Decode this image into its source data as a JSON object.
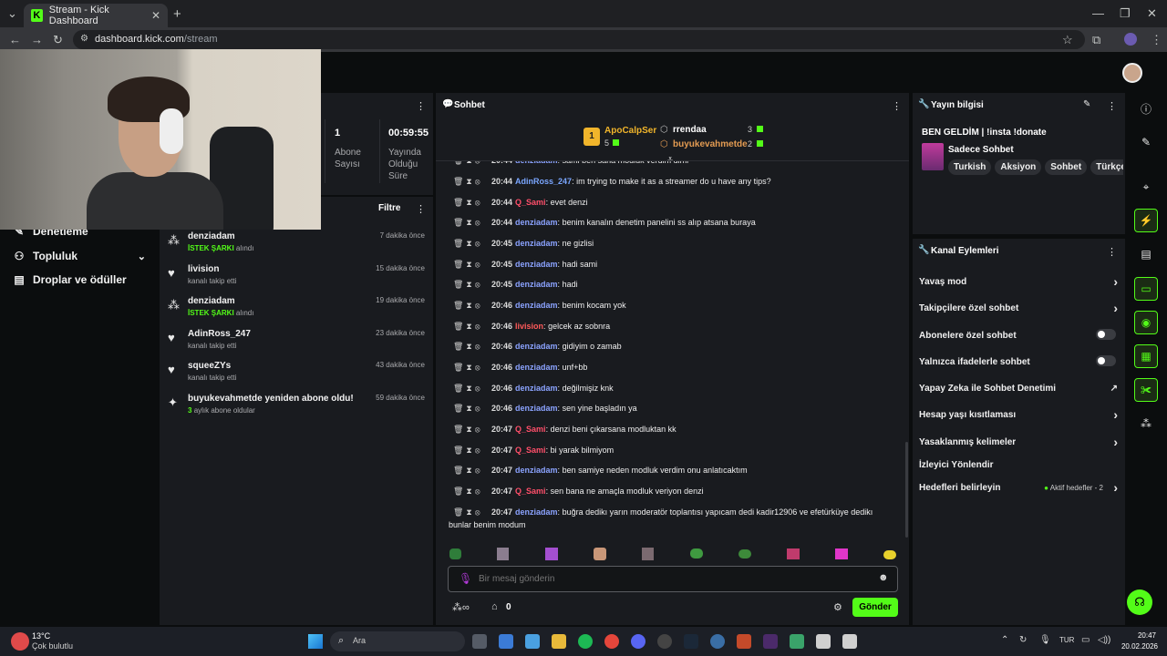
{
  "browser": {
    "tab_title": "Stream - Kick Dashboard",
    "url_host": "dashboard.kick.com",
    "url_path": "/stream",
    "favicon_letter": "K"
  },
  "sidebar": {
    "items": [
      {
        "label": "Denetleme",
        "icon": "shield-icon"
      },
      {
        "label": "Topluluk",
        "icon": "people-icon"
      },
      {
        "label": "Droplar ve ödüller",
        "icon": "gift-icon"
      }
    ]
  },
  "stats": {
    "subs_value": "1",
    "subs_label_1": "Abone",
    "subs_label_2": "Sayısı",
    "uptime_value": "00:59:55",
    "uptime_label_1": "Yayında",
    "uptime_label_2": "Olduğu",
    "uptime_label_3": "Süre"
  },
  "activity": {
    "filter_label": "Filtre",
    "items": [
      {
        "user": "denziadam",
        "desc_highlight": "İSTEK ŞARKI",
        "desc": "alındı",
        "time": "7 dakika önce",
        "icon": "bits-icon"
      },
      {
        "user": "livision",
        "desc_highlight": "",
        "desc": "kanalı takip etti",
        "time": "15 dakika önce",
        "icon": "heart-icon"
      },
      {
        "user": "denziadam",
        "desc_highlight": "İSTEK ŞARKI",
        "desc": "alındı",
        "time": "19 dakika önce",
        "icon": "bits-icon"
      },
      {
        "user": "AdinRoss_247",
        "desc_highlight": "",
        "desc": "kanalı takip etti",
        "time": "23 dakika önce",
        "icon": "heart-icon"
      },
      {
        "user": "squeeZYs",
        "desc_highlight": "",
        "desc": "kanalı takip etti",
        "time": "43 dakika önce",
        "icon": "heart-icon"
      },
      {
        "user": "buyukevahmetde yeniden abone oldu!",
        "desc_highlight": "3",
        "desc": "aylık abone oldular",
        "time": "59 dakika önce",
        "icon": "star-icon"
      }
    ]
  },
  "chat": {
    "title": "Sohbet",
    "leaderboard": {
      "first_user": "ApoCalpSer",
      "first_count": "5",
      "first_rank": "1",
      "second_user": "rrendaa",
      "second_count": "3",
      "third_user": "buyukevahmetde",
      "third_count": "2"
    },
    "messages": [
      {
        "time": "20:44",
        "user": "denziadam",
        "text": "sami ben sana modluk verdim dimi",
        "color": "den"
      },
      {
        "time": "20:44",
        "user": "AdinRoss_247",
        "text": "im trying to make it as a streamer do u have any tips?",
        "color": "blue"
      },
      {
        "time": "20:44",
        "user": "Q_Sami",
        "text": "evet denzi",
        "color": "red"
      },
      {
        "time": "20:44",
        "user": "denziadam",
        "text": "benim kanalın denetim panelini ss alıp atsana buraya",
        "color": "den"
      },
      {
        "time": "20:45",
        "user": "denziadam",
        "text": "ne gizlisi",
        "color": "den"
      },
      {
        "time": "20:45",
        "user": "denziadam",
        "text": "hadi sami",
        "color": "den"
      },
      {
        "time": "20:45",
        "user": "denziadam",
        "text": "hadi",
        "color": "den"
      },
      {
        "time": "20:46",
        "user": "denziadam",
        "text": "benim kocam yok",
        "color": "den"
      },
      {
        "time": "20:46",
        "user": "livision",
        "text": "gelcek az sobnra",
        "color": "red2"
      },
      {
        "time": "20:46",
        "user": "denziadam",
        "text": "gidiyim o zamab",
        "color": "den"
      },
      {
        "time": "20:46",
        "user": "denziadam",
        "text": "unf+bb",
        "color": "den"
      },
      {
        "time": "20:46",
        "user": "denziadam",
        "text": "değilmişiz knk",
        "color": "den"
      },
      {
        "time": "20:46",
        "user": "denziadam",
        "text": "sen yine başladın ya",
        "color": "den"
      },
      {
        "time": "20:47",
        "user": "Q_Sami",
        "text": "denzi beni çıkarsana modluktan kk",
        "color": "red"
      },
      {
        "time": "20:47",
        "user": "Q_Sami",
        "text": "bi yarak bilmiyom",
        "color": "red"
      },
      {
        "time": "20:47",
        "user": "denziadam",
        "text": "ben samiye neden modluk verdim onu anlatıcaktım",
        "color": "den"
      },
      {
        "time": "20:47",
        "user": "Q_Sami",
        "text": "sen bana ne amaçla modluk veriyon denzi",
        "color": "red"
      },
      {
        "time": "20:47",
        "user": "denziadam",
        "text": "buğra dedikı yarın moderatör toplantısı yapıcam dedi kadir12906 ve efetürküye dedikı",
        "color": "den"
      }
    ],
    "last_line_cont": "bunlar benim modum",
    "input_placeholder": "Bir mesaj gönderin",
    "send_label": "Gönder",
    "points_value": "0"
  },
  "stream_info": {
    "title": "Yayın bilgisi",
    "stream_title": "BEN GELDİM | !insta !donate",
    "category": "Sadece Sohbet",
    "tags": [
      "Turkish",
      "Aksiyon",
      "Sohbet",
      "Türkçe"
    ]
  },
  "channel_actions": {
    "title": "Kanal Eylemleri",
    "items": [
      {
        "label": "Yavaş mod",
        "control": "chevron"
      },
      {
        "label": "Takipçilere özel sohbet",
        "control": "chevron"
      },
      {
        "label": "Abonelere özel sohbet",
        "control": "toggle"
      },
      {
        "label": "Yalnızca ifadelerle sohbet",
        "control": "toggle"
      },
      {
        "label": "Yapay Zeka ile Sohbet Denetimi",
        "control": "external"
      },
      {
        "label": "Hesap yaşı kısıtlaması",
        "control": "chevron"
      },
      {
        "label": "Yasaklanmış kelimeler",
        "control": "chevron"
      },
      {
        "label": "İzleyici Yönlendir",
        "control": "none"
      },
      {
        "label": "Hedefleri belirleyin",
        "control": "goals"
      }
    ],
    "goals_status": "Aktif hedefler - 2"
  },
  "taskbar": {
    "weather_temp": "13°C",
    "weather_desc": "Çok bulutlu",
    "search_label": "Ara",
    "lang": "TUR",
    "clock_time": "20:47",
    "clock_date": "20.02.2026"
  },
  "colors": {
    "kick_green": "#53fc18",
    "panel": "#191b1f",
    "background": "#0b0d0e"
  }
}
